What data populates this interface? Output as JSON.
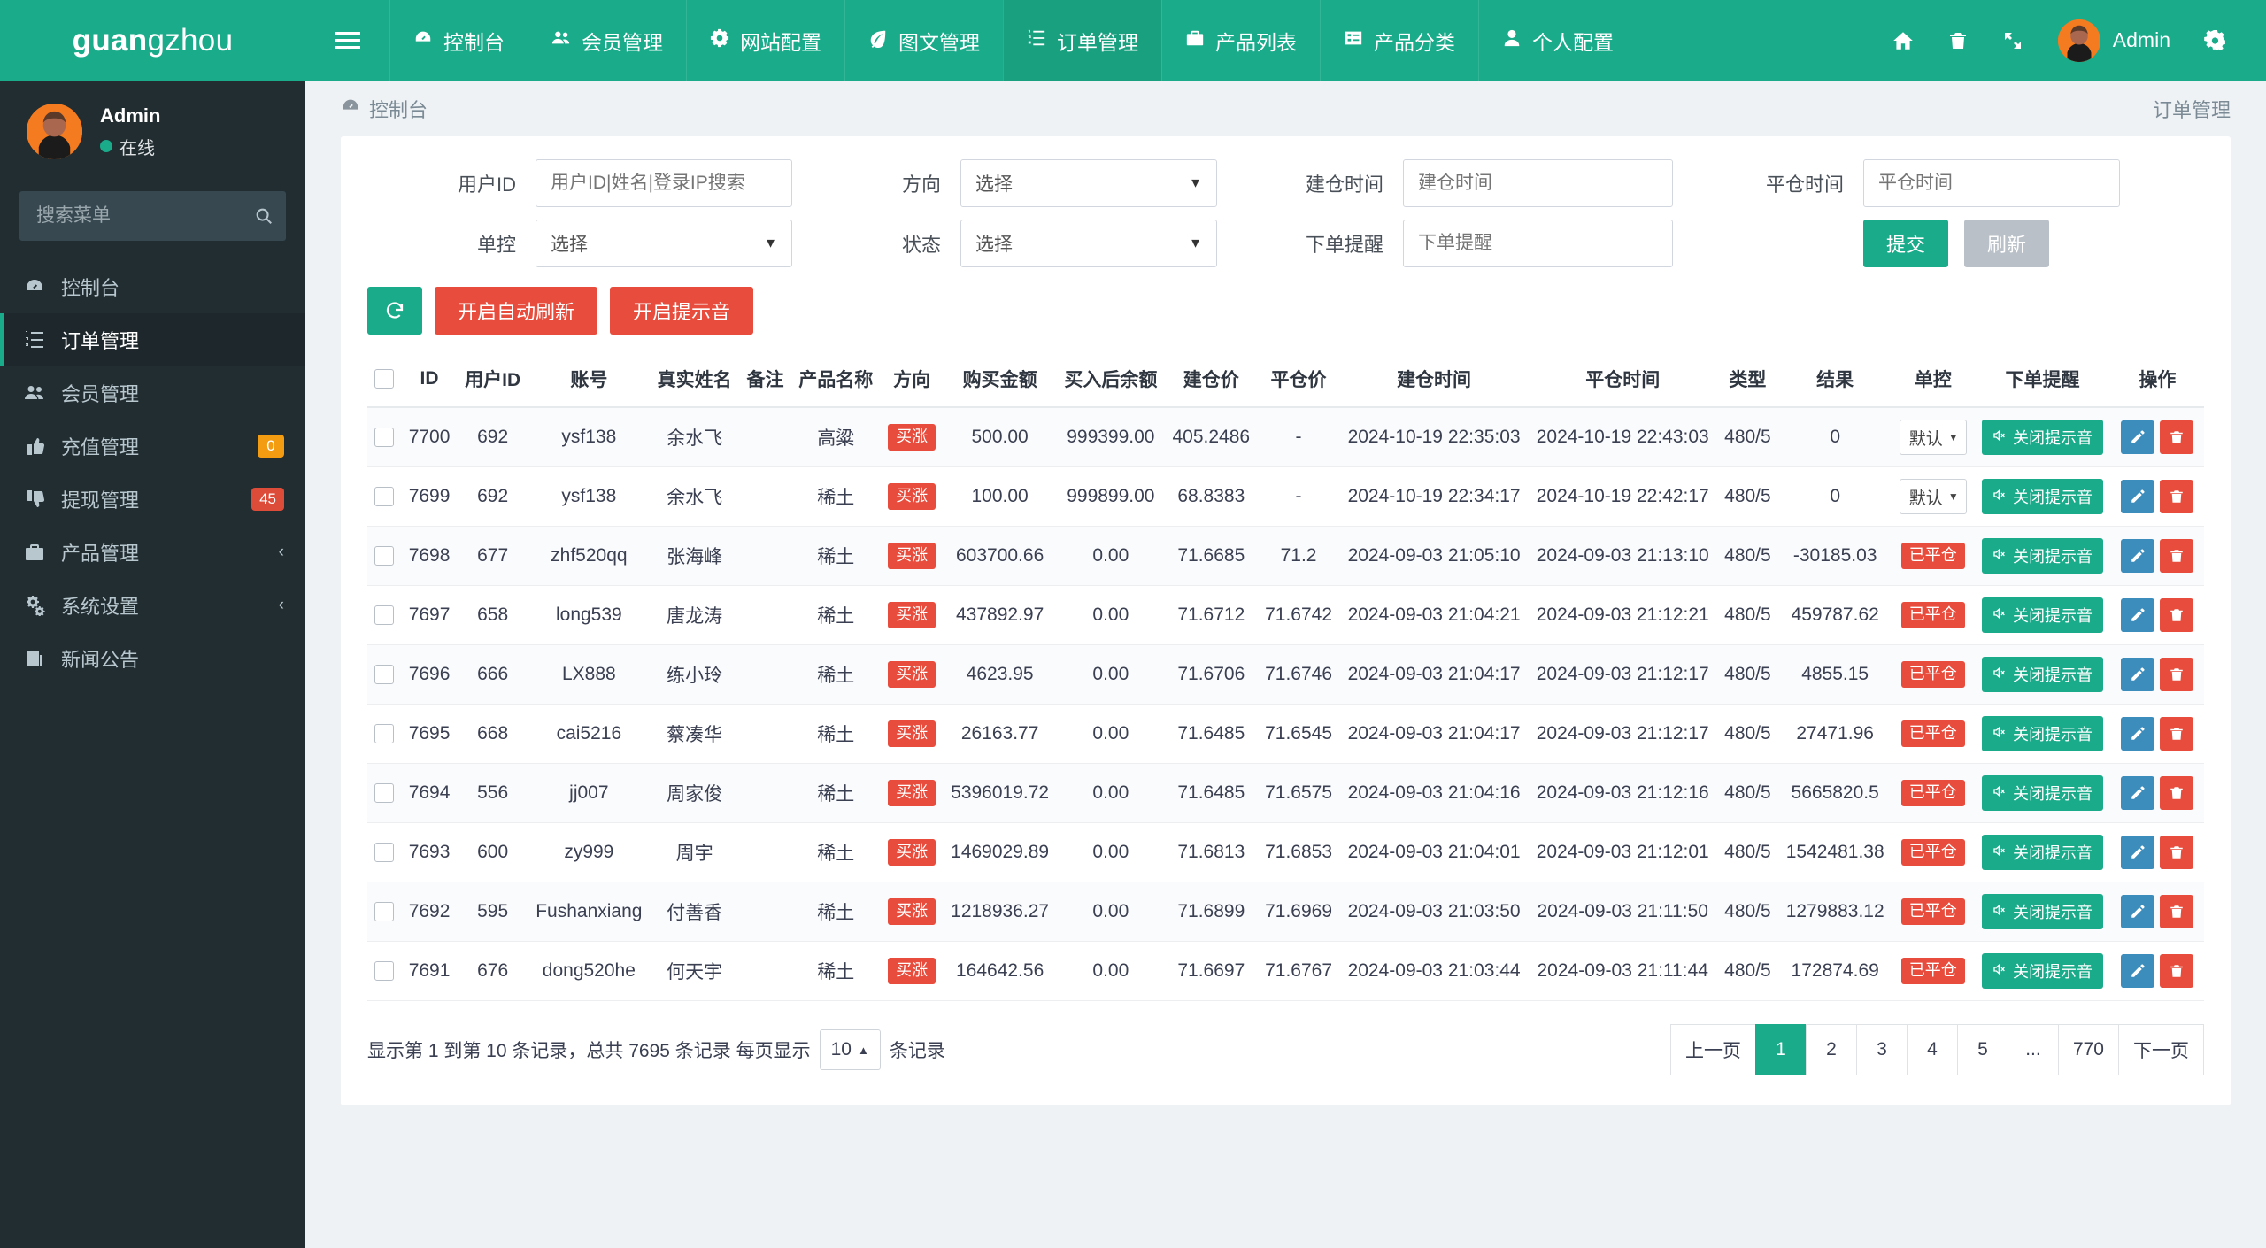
{
  "brand": {
    "part1": "guan",
    "part2": "gzhou"
  },
  "user_panel": {
    "name": "Admin",
    "status": "在线"
  },
  "search": {
    "placeholder": "搜索菜单",
    "icon": "search-icon"
  },
  "sidebar": {
    "items": [
      {
        "label": "控制台",
        "icon": "dashboard-icon",
        "badge": "",
        "badge_color": "",
        "chevron": "",
        "active": false
      },
      {
        "label": "订单管理",
        "icon": "ordered-list-icon",
        "badge": "",
        "badge_color": "",
        "chevron": "",
        "active": true
      },
      {
        "label": "会员管理",
        "icon": "users-icon",
        "badge": "",
        "badge_color": "",
        "chevron": "",
        "active": false
      },
      {
        "label": "充值管理",
        "icon": "thumbs-up-icon",
        "badge": "0",
        "badge_color": "#f39c12",
        "chevron": "",
        "active": false
      },
      {
        "label": "提现管理",
        "icon": "thumbs-down-icon",
        "badge": "45",
        "badge_color": "#dd4b39",
        "chevron": "",
        "active": false
      },
      {
        "label": "产品管理",
        "icon": "briefcase-icon",
        "badge": "",
        "badge_color": "",
        "chevron": "‹",
        "active": false
      },
      {
        "label": "系统设置",
        "icon": "gears-icon",
        "badge": "",
        "badge_color": "",
        "chevron": "‹",
        "active": false
      },
      {
        "label": "新闻公告",
        "icon": "news-icon",
        "badge": "",
        "badge_color": "",
        "chevron": "",
        "active": false
      }
    ]
  },
  "topnav": {
    "toggle_icon": "hamburger-icon",
    "items": [
      {
        "label": "控制台",
        "icon": "dashboard-icon",
        "active": false
      },
      {
        "label": "会员管理",
        "icon": "users-icon",
        "active": false
      },
      {
        "label": "网站配置",
        "icon": "gear-icon",
        "active": false
      },
      {
        "label": "图文管理",
        "icon": "leaf-icon",
        "active": false
      },
      {
        "label": "订单管理",
        "icon": "ordered-list-icon",
        "active": true
      },
      {
        "label": "产品列表",
        "icon": "briefcase-icon",
        "active": false
      },
      {
        "label": "产品分类",
        "icon": "list-alt-icon",
        "active": false
      },
      {
        "label": "个人配置",
        "icon": "user-icon",
        "active": false
      }
    ],
    "right_icons": [
      "home-icon",
      "trash-icon",
      "expand-icon"
    ],
    "user_label": "Admin",
    "settings_icon": "cogs-icon"
  },
  "content_header": {
    "breadcrumb": "控制台",
    "breadcrumb_icon": "dashboard-icon",
    "right": "订单管理"
  },
  "filters": {
    "user_id": {
      "label": "用户ID",
      "placeholder": "用户ID|姓名|登录IP搜索",
      "value": ""
    },
    "direction": {
      "label": "方向",
      "value": "选择"
    },
    "open_time": {
      "label": "建仓时间",
      "placeholder": "建仓时间",
      "value": ""
    },
    "close_time": {
      "label": "平仓时间",
      "placeholder": "平仓时间",
      "value": ""
    },
    "single_control": {
      "label": "单控",
      "value": "选择"
    },
    "status": {
      "label": "状态",
      "value": "选择"
    },
    "order_alert": {
      "label": "下单提醒",
      "placeholder": "下单提醒",
      "value": ""
    },
    "submit_label": "提交",
    "reset_label": "刷新"
  },
  "toolbar": {
    "refresh_icon": "refresh-icon",
    "auto_refresh_label": "开启自动刷新",
    "sound_label": "开启提示音"
  },
  "table": {
    "columns": [
      "",
      "ID",
      "用户ID",
      "账号",
      "真实姓名",
      "备注",
      "产品名称",
      "方向",
      "购买金额",
      "买入后余额",
      "建仓价",
      "平仓价",
      "建仓时间",
      "平仓时间",
      "类型",
      "结果",
      "单控",
      "下单提醒",
      "操作"
    ],
    "single_control_option": "默认",
    "alert_button_label": "关闭提示音",
    "edit_icon": "pencil-icon",
    "delete_icon": "trash-icon",
    "rows": [
      {
        "id": "7700",
        "user_id": "692",
        "account": "ysf138",
        "real_name": "余水飞",
        "remark": "",
        "product": "高粱",
        "direction": "买涨",
        "amount": "500.00",
        "balance_after": "999399.00",
        "open_price": "405.2486",
        "close_price": "-",
        "open_time": "2024-10-19 22:35:03",
        "close_time": "2024-10-19 22:43:03",
        "type": "480/5",
        "result": "0",
        "status_tag": "",
        "has_select": true
      },
      {
        "id": "7699",
        "user_id": "692",
        "account": "ysf138",
        "real_name": "余水飞",
        "remark": "",
        "product": "稀土",
        "direction": "买涨",
        "amount": "100.00",
        "balance_after": "999899.00",
        "open_price": "68.8383",
        "close_price": "-",
        "open_time": "2024-10-19 22:34:17",
        "close_time": "2024-10-19 22:42:17",
        "type": "480/5",
        "result": "0",
        "status_tag": "",
        "has_select": true
      },
      {
        "id": "7698",
        "user_id": "677",
        "account": "zhf520qq",
        "real_name": "张海峰",
        "remark": "",
        "product": "稀土",
        "direction": "买涨",
        "amount": "603700.66",
        "balance_after": "0.00",
        "open_price": "71.6685",
        "close_price": "71.2",
        "open_time": "2024-09-03 21:05:10",
        "close_time": "2024-09-03 21:13:10",
        "type": "480/5",
        "result": "-30185.03",
        "status_tag": "已平仓",
        "has_select": false
      },
      {
        "id": "7697",
        "user_id": "658",
        "account": "long539",
        "real_name": "唐龙涛",
        "remark": "",
        "product": "稀土",
        "direction": "买涨",
        "amount": "437892.97",
        "balance_after": "0.00",
        "open_price": "71.6712",
        "close_price": "71.6742",
        "open_time": "2024-09-03 21:04:21",
        "close_time": "2024-09-03 21:12:21",
        "type": "480/5",
        "result": "459787.62",
        "status_tag": "已平仓",
        "has_select": false
      },
      {
        "id": "7696",
        "user_id": "666",
        "account": "LX888",
        "real_name": "练小玲",
        "remark": "",
        "product": "稀土",
        "direction": "买涨",
        "amount": "4623.95",
        "balance_after": "0.00",
        "open_price": "71.6706",
        "close_price": "71.6746",
        "open_time": "2024-09-03 21:04:17",
        "close_time": "2024-09-03 21:12:17",
        "type": "480/5",
        "result": "4855.15",
        "status_tag": "已平仓",
        "has_select": false
      },
      {
        "id": "7695",
        "user_id": "668",
        "account": "cai5216",
        "real_name": "蔡凑华",
        "remark": "",
        "product": "稀土",
        "direction": "买涨",
        "amount": "26163.77",
        "balance_after": "0.00",
        "open_price": "71.6485",
        "close_price": "71.6545",
        "open_time": "2024-09-03 21:04:17",
        "close_time": "2024-09-03 21:12:17",
        "type": "480/5",
        "result": "27471.96",
        "status_tag": "已平仓",
        "has_select": false
      },
      {
        "id": "7694",
        "user_id": "556",
        "account": "jj007",
        "real_name": "周家俊",
        "remark": "",
        "product": "稀土",
        "direction": "买涨",
        "amount": "5396019.72",
        "balance_after": "0.00",
        "open_price": "71.6485",
        "close_price": "71.6575",
        "open_time": "2024-09-03 21:04:16",
        "close_time": "2024-09-03 21:12:16",
        "type": "480/5",
        "result": "5665820.5",
        "status_tag": "已平仓",
        "has_select": false
      },
      {
        "id": "7693",
        "user_id": "600",
        "account": "zy999",
        "real_name": "周宇",
        "remark": "",
        "product": "稀土",
        "direction": "买涨",
        "amount": "1469029.89",
        "balance_after": "0.00",
        "open_price": "71.6813",
        "close_price": "71.6853",
        "open_time": "2024-09-03 21:04:01",
        "close_time": "2024-09-03 21:12:01",
        "type": "480/5",
        "result": "1542481.38",
        "status_tag": "已平仓",
        "has_select": false
      },
      {
        "id": "7692",
        "user_id": "595",
        "account": "Fushanxiang",
        "real_name": "付善香",
        "remark": "",
        "product": "稀土",
        "direction": "买涨",
        "amount": "1218936.27",
        "balance_after": "0.00",
        "open_price": "71.6899",
        "close_price": "71.6969",
        "open_time": "2024-09-03 21:03:50",
        "close_time": "2024-09-03 21:11:50",
        "type": "480/5",
        "result": "1279883.12",
        "status_tag": "已平仓",
        "has_select": false
      },
      {
        "id": "7691",
        "user_id": "676",
        "account": "dong520he",
        "real_name": "何天宇",
        "remark": "",
        "product": "稀土",
        "direction": "买涨",
        "amount": "164642.56",
        "balance_after": "0.00",
        "open_price": "71.6697",
        "close_price": "71.6767",
        "open_time": "2024-09-03 21:03:44",
        "close_time": "2024-09-03 21:11:44",
        "type": "480/5",
        "result": "172874.69",
        "status_tag": "已平仓",
        "has_select": false
      }
    ]
  },
  "footer": {
    "info_prefix": "显示第 1 到第 10 条记录，总共 7695 条记录 每页显示",
    "page_size": "10",
    "info_suffix": "条记录",
    "pager": {
      "prev": "上一页",
      "next": "下一页",
      "pages": [
        "1",
        "2",
        "3",
        "4",
        "5",
        "...",
        "770"
      ],
      "current": "1"
    }
  },
  "colors": {
    "brand_green": "#1aab8a",
    "sidebar_dark": "#222d32",
    "danger_red": "#e74c3c",
    "warning_orange": "#f39c12",
    "info_blue": "#3c8dbc"
  }
}
